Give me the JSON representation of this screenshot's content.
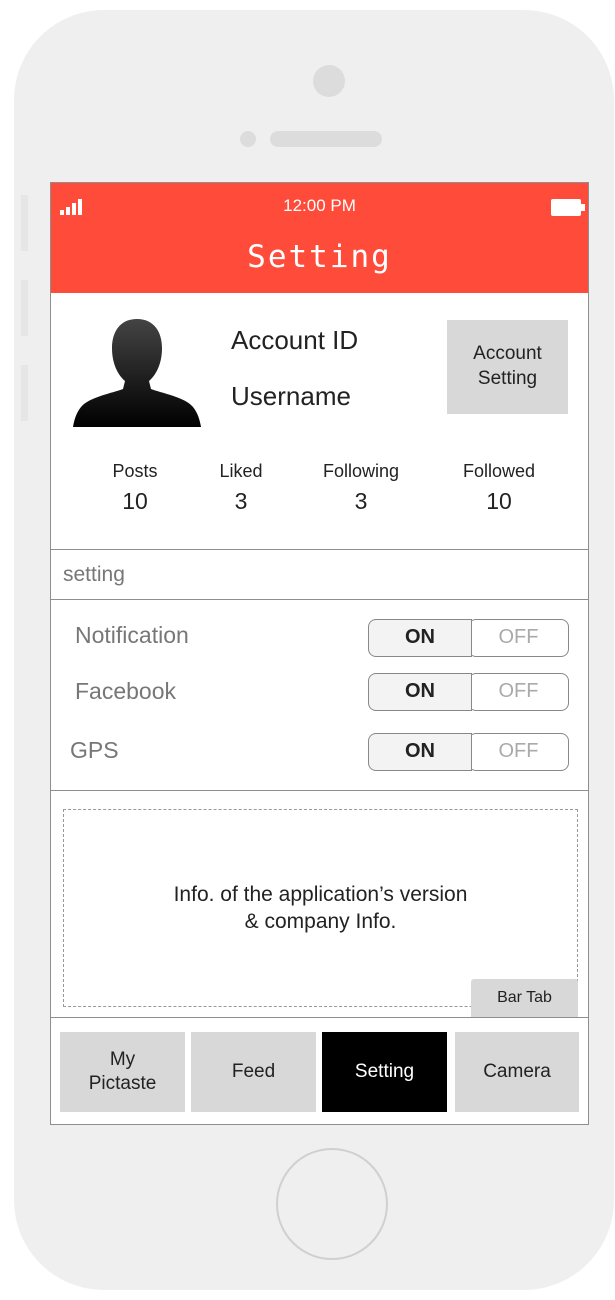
{
  "status_bar": {
    "time": "12:00 PM"
  },
  "header": {
    "title": "Setting"
  },
  "profile": {
    "account_id": "Account ID",
    "username": "Username",
    "account_setting_line1": "Account",
    "account_setting_line2": "Setting",
    "stats": [
      {
        "label": "Posts",
        "value": "10"
      },
      {
        "label": "Liked",
        "value": "3"
      },
      {
        "label": "Following",
        "value": "3"
      },
      {
        "label": "Followed",
        "value": "10"
      }
    ]
  },
  "section": {
    "label": "setting"
  },
  "settings": [
    {
      "label": "Notification",
      "on": "ON",
      "off": "OFF",
      "state": "ON"
    },
    {
      "label": "Facebook",
      "on": "ON",
      "off": "OFF",
      "state": "ON"
    },
    {
      "label": "GPS",
      "on": "ON",
      "off": "OFF",
      "state": "ON"
    }
  ],
  "info": {
    "line1": "Info. of the application’s version",
    "line2": "& company Info."
  },
  "bar_tab_label": "Bar Tab",
  "tabs": [
    {
      "line1": "My",
      "line2": "Pictaste",
      "active": false
    },
    {
      "line1": "Feed",
      "line2": "",
      "active": false
    },
    {
      "line1": "Setting",
      "line2": "",
      "active": true
    },
    {
      "line1": "Camera",
      "line2": "",
      "active": false
    }
  ],
  "colors": {
    "header_bg": "#ff4b3a",
    "active_tab_bg": "#000000",
    "button_bg": "#d8d8d8"
  },
  "icons": [
    "signal-icon",
    "battery-icon",
    "avatar-silhouette-icon"
  ]
}
